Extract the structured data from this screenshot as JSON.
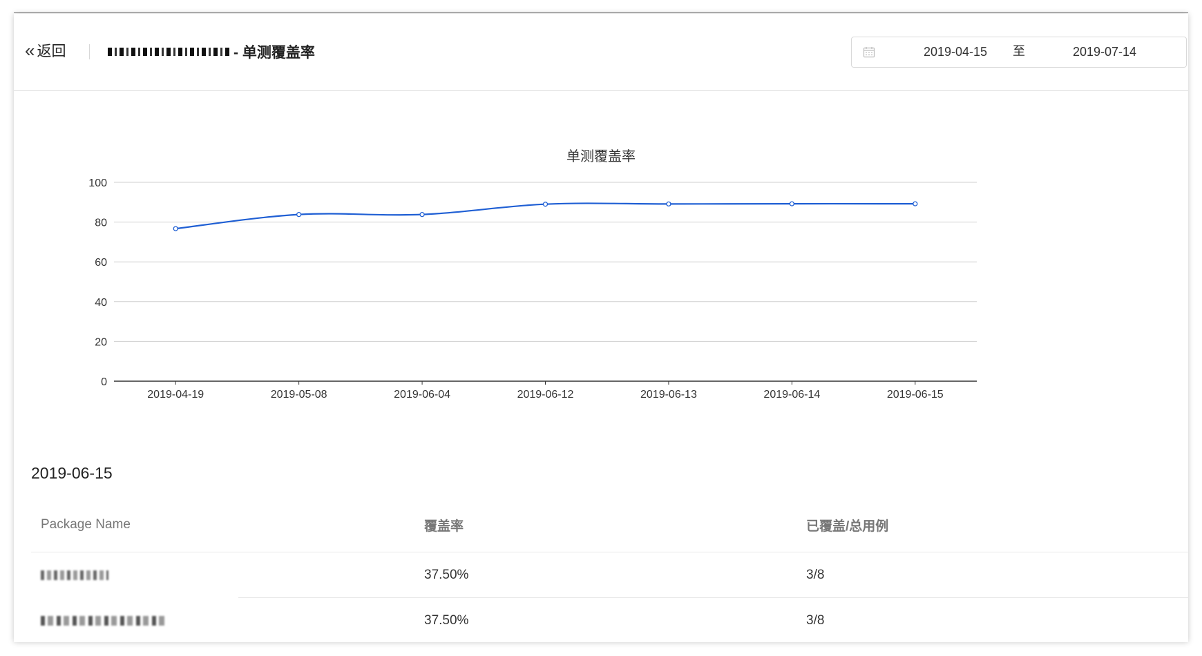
{
  "header": {
    "back_label": "返回",
    "title_suffix": "- 单测覆盖率"
  },
  "date_range": {
    "start": "2019-04-15",
    "separator": "至",
    "end": "2019-07-14"
  },
  "chart_data": {
    "type": "line",
    "title": "单测覆盖率",
    "xlabel": "",
    "ylabel": "",
    "categories": [
      "2019-04-19",
      "2019-05-08",
      "2019-06-04",
      "2019-06-12",
      "2019-06-13",
      "2019-06-14",
      "2019-06-15"
    ],
    "series": [
      {
        "values": [
          76.7,
          83.8,
          83.8,
          89.0,
          89.1,
          89.2,
          89.2
        ],
        "color": "#1f5fd4"
      }
    ],
    "ylim": [
      0,
      100
    ],
    "yticks": [
      0,
      20,
      40,
      60,
      80,
      100
    ],
    "grid": true,
    "smooth": true
  },
  "detail": {
    "date": "2019-06-15",
    "columns": [
      "Package Name",
      "覆盖率",
      "已覆盖/总用例"
    ],
    "rows": [
      {
        "coverage": "37.50%",
        "ratio": "3/8"
      },
      {
        "coverage": "37.50%",
        "ratio": "3/8"
      }
    ]
  }
}
